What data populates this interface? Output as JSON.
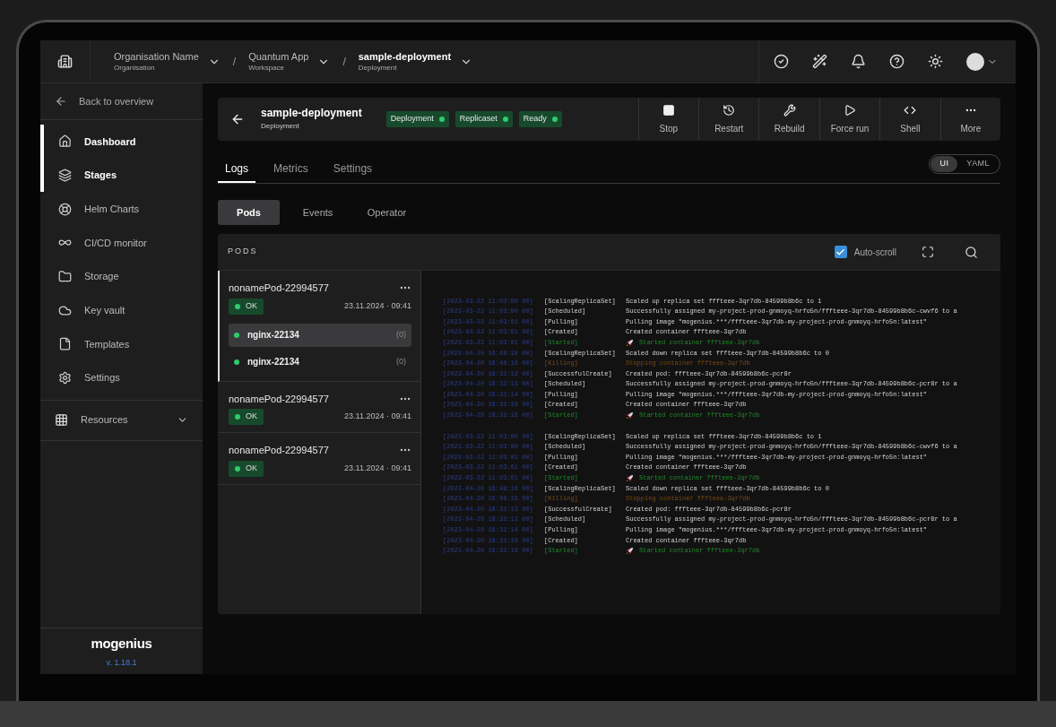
{
  "topbar": {
    "breadcrumbs": [
      {
        "name": "Organisation Name",
        "sub": "Organisation",
        "current": false
      },
      {
        "name": "Quantum App",
        "sub": "Workspace",
        "current": false
      },
      {
        "name": "sample-deployment",
        "sub": "Deployment",
        "current": true
      }
    ],
    "separators": [
      "/",
      "/"
    ]
  },
  "sidebar": {
    "back": "Back to overview",
    "items": [
      {
        "label": "Dashboard",
        "selected": true
      },
      {
        "label": "Stages",
        "selected": true
      },
      {
        "label": "Helm Charts",
        "selected": false
      },
      {
        "label": "CI/CD monitor",
        "selected": false
      },
      {
        "label": "Storage",
        "selected": false
      },
      {
        "label": "Key vault",
        "selected": false
      },
      {
        "label": "Templates",
        "selected": false
      },
      {
        "label": "Settings",
        "selected": false
      }
    ],
    "resources": "Resources",
    "logo": "mogenius",
    "version": "v. 1.18.1"
  },
  "header": {
    "title": "sample-deployment",
    "subtitle": "Deployment",
    "tags": [
      "Deployment",
      "Replicaset",
      "Ready"
    ],
    "actions": [
      "Stop",
      "Restart",
      "Rebuild",
      "Force run",
      "Shell",
      "More"
    ]
  },
  "tabs": [
    {
      "label": "Logs",
      "selected": true
    },
    {
      "label": "Metrics",
      "selected": false
    },
    {
      "label": "Settings",
      "selected": false
    }
  ],
  "view_toggle": [
    {
      "label": "UI",
      "selected": true
    },
    {
      "label": "YAML",
      "selected": false
    }
  ],
  "subtabs": [
    {
      "label": "Pods",
      "selected": true
    },
    {
      "label": "Events",
      "selected": false
    },
    {
      "label": "Operator",
      "selected": false
    }
  ],
  "pods_panel": {
    "title": "PODS",
    "auto_scroll": {
      "label": "Auto-scroll",
      "checked": true
    },
    "pods": [
      {
        "name": "nonamePod-22994577",
        "status": "OK",
        "time": "23.11.2024 · 09:41",
        "selected": true,
        "containers": [
          {
            "name": "nginx-22134",
            "count": "(0)",
            "selected": true
          },
          {
            "name": "nginx-22134",
            "count": "(0)",
            "selected": false
          }
        ]
      },
      {
        "name": "nonamePod-22994577",
        "status": "OK",
        "time": "23.11.2024 · 09:41",
        "selected": false
      },
      {
        "name": "nonamePod-22994577",
        "status": "OK",
        "time": "23.11.2024 · 09:41",
        "selected": false
      }
    ],
    "log_groups": [
      [
        {
          "kind": "info",
          "time": "[2023-03-22 11:03:00 00]",
          "type": "[ScalingReplicaSet]",
          "message": "Scaled up replica set fffteee-3qr7db-84599b8b6c to 1"
        },
        {
          "kind": "info",
          "time": "[2023-03-22 11:03:00 00]",
          "type": "[Scheduled]",
          "message": "Successfully assigned my-project-prod-gnmoyq-hrfo5n/fffteee-3qr7db-84599b8b6c-cwvf6 to a"
        },
        {
          "kind": "info",
          "time": "[2023-03-22 11:03:01 00]",
          "type": "[Pulling]",
          "message": "Pulling image \"mogenius.***/fffteee-3qr7db-my-project-prod-gnmoyq-hrfo5n:latest\""
        },
        {
          "kind": "info",
          "time": "[2023-03-22 11:03:01 00]",
          "type": "[Created]",
          "message": "Created container fffteee-3qr7db"
        },
        {
          "kind": "started",
          "time": "[2023-03-22 11:03:01 00]",
          "type": "[Started]",
          "message": "Started container fffteee-3qr7db"
        },
        {
          "kind": "info",
          "time": "[2023-04-20 16:48:18 00]",
          "type": "[ScalingReplicaSet]",
          "message": "Scaled down replica set fffteee-3qr7db-84599b8b6c to 0"
        },
        {
          "kind": "killing",
          "time": "[2023-04-20 16:48:18 00]",
          "type": "[Killing]",
          "message": "Stopping container fffteee-3qr7db"
        },
        {
          "kind": "info",
          "time": "[2023-04-20 18:32:13 00]",
          "type": "[SuccessfulCreate]",
          "message": "Created pod: fffteee-3qr7db-84599b8b6c-pcr8r"
        },
        {
          "kind": "info",
          "time": "[2023-04-20 18:32:13 00]",
          "type": "[Scheduled]",
          "message": "Successfully assigned my-project-prod-gnmoyq-hrfo5n/fffteee-3qr7db-84599b8b6c-pcr8r to a"
        },
        {
          "kind": "info",
          "time": "[2023-04-20 18:32:14 00]",
          "type": "[Pulling]",
          "message": "Pulling image \"mogenius.***/fffteee-3qr7db-my-project-prod-gnmoyq-hrfo5n:latest\""
        },
        {
          "kind": "info",
          "time": "[2023-04-20 18:32:16 00]",
          "type": "[Created]",
          "message": "Created container fffteee-3qr7db"
        },
        {
          "kind": "started",
          "time": "[2023-04-20 18:32:16 00]",
          "type": "[Started]",
          "message": "Started container fffteee-3qr7db"
        }
      ],
      [
        {
          "kind": "info",
          "time": "[2023-03-22 11:03:00 00]",
          "type": "[ScalingReplicaSet]",
          "message": "Scaled up replica set fffteee-3qr7db-84599b8b6c to 1"
        },
        {
          "kind": "info",
          "time": "[2023-03-22 11:03:00 00]",
          "type": "[Scheduled]",
          "message": "Successfully assigned my-project-prod-gnmoyq-hrfo5n/fffteee-3qr7db-84599b8b6c-cwvf6 to a"
        },
        {
          "kind": "info",
          "time": "[2023-03-22 11:03:01 00]",
          "type": "[Pulling]",
          "message": "Pulling image \"mogenius.***/fffteee-3qr7db-my-project-prod-gnmoyq-hrfo5n:latest\""
        },
        {
          "kind": "info",
          "time": "[2023-03-22 11:03:01 00]",
          "type": "[Created]",
          "message": "Created container fffteee-3qr7db"
        },
        {
          "kind": "started",
          "time": "[2023-03-22 11:03:01 00]",
          "type": "[Started]",
          "message": "Started container fffteee-3qr7db"
        },
        {
          "kind": "info",
          "time": "[2023-04-20 16:48:18 00]",
          "type": "[ScalingReplicaSet]",
          "message": "Scaled down replica set fffteee-3qr7db-84599b8b6c to 0"
        },
        {
          "kind": "killing",
          "time": "[2023-04-20 16:48:18 00]",
          "type": "[Killing]",
          "message": "Stopping container fffteee-3qr7db"
        },
        {
          "kind": "info",
          "time": "[2023-04-20 18:32:13 00]",
          "type": "[SuccessfulCreate]",
          "message": "Created pod: fffteee-3qr7db-84599b8b6c-pcr8r"
        },
        {
          "kind": "info",
          "time": "[2023-04-20 18:32:13 00]",
          "type": "[Scheduled]",
          "message": "Successfully assigned my-project-prod-gnmoyq-hrfo5n/fffteee-3qr7db-84599b8b6c-pcr8r to a"
        },
        {
          "kind": "info",
          "time": "[2023-04-20 18:32:14 00]",
          "type": "[Pulling]",
          "message": "Pulling image \"mogenius.***/fffteee-3qr7db-my-project-prod-gnmoyq-hrfo5n:latest\""
        },
        {
          "kind": "info",
          "time": "[2023-04-20 18:32:16 00]",
          "type": "[Created]",
          "message": "Created container fffteee-3qr7db"
        },
        {
          "kind": "started",
          "time": "[2023-04-20 18:32:16 00]",
          "type": "[Started]",
          "message": "Started container fffteee-3qr7db"
        }
      ]
    ]
  }
}
